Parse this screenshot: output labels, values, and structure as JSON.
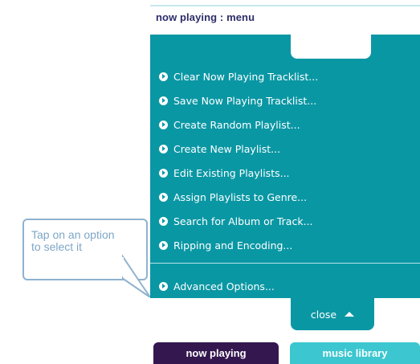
{
  "callout": {
    "text": "Tap on an option to select it"
  },
  "header": {
    "title": "now playing : menu"
  },
  "menu": {
    "items": [
      "Clear Now Playing Tracklist...",
      "Save Now Playing Tracklist...",
      "Create Random Playlist...",
      "Create New Playlist...",
      "Edit Existing Playlists...",
      "Assign Playlists to Genre...",
      "Search for Album or Track...",
      "Ripping and Encoding..."
    ],
    "advanced": "Advanced Options...",
    "close_label": "close"
  },
  "tabs": {
    "now_playing": "now playing",
    "music_library": "music library"
  },
  "colors": {
    "teal": "#0a97a4",
    "title": "#2d2d6b",
    "now_playing_tab": "#34174f",
    "music_library_tab": "#3cc7d0",
    "callout_border": "#8fb2cf"
  }
}
